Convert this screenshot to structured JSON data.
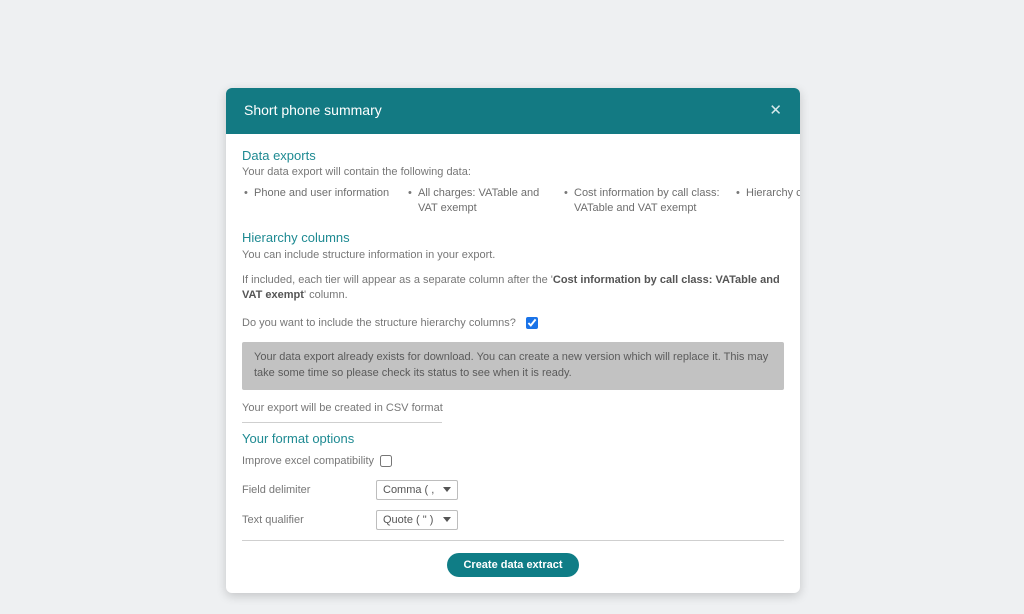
{
  "modal": {
    "title": "Short phone summary"
  },
  "dataExports": {
    "heading": "Data exports",
    "lead": "Your data export will contain the following data:",
    "items": [
      "Phone and user information",
      "All charges: VATable and VAT exempt",
      "Cost information by call class: VATable and VAT exempt",
      "Hierarchy columns"
    ]
  },
  "hierarchy": {
    "heading": "Hierarchy columns",
    "p1": "You can include structure information in your export.",
    "p2_pre": "If included, each tier will appear as a separate column after the '",
    "p2_bold": "Cost information by call class: VATable and VAT exempt",
    "p2_post": "' column.",
    "question": "Do you want to include the structure hierarchy columns?",
    "checked": true
  },
  "info": "Your data export already exists for download. You can create a new version which will replace it. This may take some time so please check its status to see when it is ready.",
  "csvNote": "Your export will be created in CSV format",
  "format": {
    "heading": "Your format options",
    "excelLabel": "Improve excel compatibility",
    "excelChecked": false,
    "delimiterLabel": "Field delimiter",
    "delimiterValue": "Comma ( , )",
    "qualifierLabel": "Text qualifier",
    "qualifierValue": "Quote ( \" )"
  },
  "action": {
    "create": "Create data extract"
  }
}
